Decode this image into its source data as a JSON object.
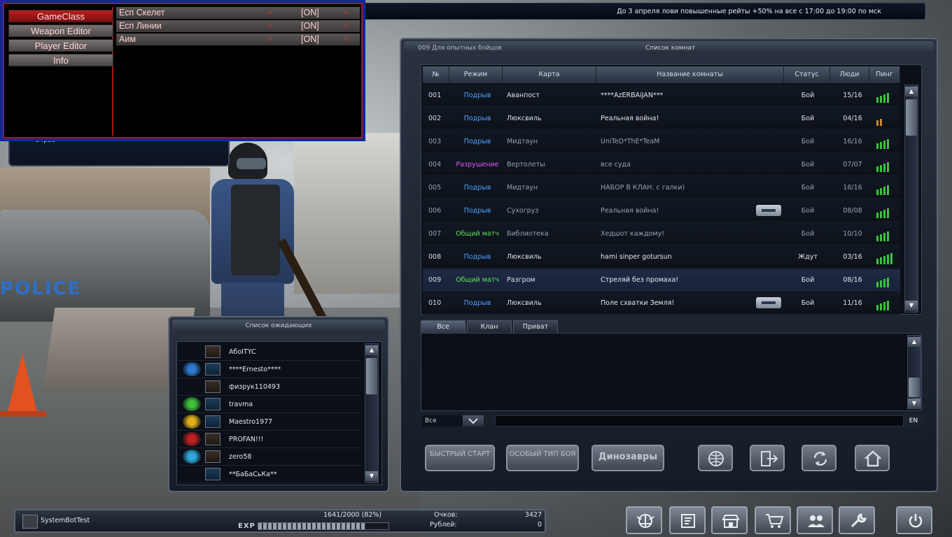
{
  "ticker": "До 3 апреля лови повышенные рейты +50% на все с 17:00 до 19:00 по мск",
  "cheat_menu": {
    "tabs": [
      "GameClass",
      "Weapon Editor",
      "Player Editor",
      "Info"
    ],
    "active_tab": "GameClass",
    "options": [
      {
        "label": "Есп Скелет",
        "value": "[ON]"
      },
      {
        "label": "Есп Линии",
        "value": "[ON]"
      },
      {
        "label": "Аим",
        "value": "[ON]"
      }
    ],
    "arrow_left": "«",
    "arrow_right": "»"
  },
  "userbox": {
    "text": "Отрас"
  },
  "room_window": {
    "group": "009 Для опытных бойцов",
    "title": "Список комнат",
    "columns": [
      "№",
      "Режим",
      "Карта",
      "Название комнаты",
      "Статус",
      "Люди",
      "Пинг"
    ],
    "rooms": [
      {
        "no": "001",
        "mode": "Подрыв",
        "mode_color": "blue",
        "map": "Аванпост",
        "name": "****AzERBAiJAN***",
        "status": "Бой",
        "people": "15/16",
        "ping": 4,
        "locked": false,
        "dim": false
      },
      {
        "no": "002",
        "mode": "Подрыв",
        "mode_color": "blue",
        "map": "Люксвиль",
        "name": "Реальная войнa!",
        "status": "Бой",
        "people": "04/16",
        "ping": 2,
        "locked": false,
        "dim": false
      },
      {
        "no": "003",
        "mode": "Подрыв",
        "mode_color": "blue",
        "map": "Мидтаун",
        "name": "UniTeD*ThE*TeaM",
        "status": "Бой",
        "people": "16/16",
        "ping": 4,
        "locked": false,
        "dim": true
      },
      {
        "no": "004",
        "mode": "Разрушение",
        "mode_color": "pink",
        "map": "Вертолеты",
        "name": "все суда",
        "status": "Бой",
        "people": "07/07",
        "ping": 4,
        "locked": false,
        "dim": true
      },
      {
        "no": "005",
        "mode": "Подрыв",
        "mode_color": "blue",
        "map": "Мидтаун",
        "name": "НАБОР В КЛАН. с галки)",
        "status": "Бой",
        "people": "16/16",
        "ping": 4,
        "locked": false,
        "dim": true
      },
      {
        "no": "006",
        "mode": "Подрыв",
        "mode_color": "blue",
        "map": "Сухогруз",
        "name": "Реальная войнa!",
        "status": "Бой",
        "people": "08/08",
        "ping": 4,
        "locked": true,
        "dim": true
      },
      {
        "no": "007",
        "mode": "Общий матч",
        "mode_color": "green",
        "map": "Библиотека",
        "name": "Хедшот каждому!",
        "status": "Бой",
        "people": "10/10",
        "ping": 4,
        "locked": false,
        "dim": true
      },
      {
        "no": "008",
        "mode": "Подрыв",
        "mode_color": "blue",
        "map": "Люксвиль",
        "name": "hami sinper  gotursun",
        "status": "Ждут",
        "people": "03/16",
        "ping": 5,
        "locked": false,
        "dim": false
      },
      {
        "no": "009",
        "mode": "Общий матч",
        "mode_color": "green",
        "map": "Разгром",
        "name": "Стреляй без промаха!",
        "status": "Бой",
        "people": "08/16",
        "ping": 4,
        "locked": false,
        "dim": false,
        "selected": true
      },
      {
        "no": "010",
        "mode": "Подрыв",
        "mode_color": "blue",
        "map": "Люксвиль",
        "name": "Поле схватки Земля!",
        "status": "Бой",
        "people": "11/16",
        "ping": 4,
        "locked": true,
        "dim": false
      }
    ],
    "chat_tabs": [
      "Все",
      "Клан",
      "Приват"
    ],
    "chat_target": "Все",
    "lang": "EN",
    "buttons": {
      "quick_start": "БЫСТРЫЙ СТАРТ",
      "special": "ОСОБЫЙ ТИП БОЯ",
      "dino": "Динозавры"
    },
    "icon_buttons": [
      "globe-icon",
      "exit-icon",
      "refresh-icon",
      "home-icon"
    ]
  },
  "waiting": {
    "title": "Список ожидающих",
    "players": [
      {
        "name": "AбoITYC",
        "clan": "",
        "rank": "brown"
      },
      {
        "name": "****Ernesto****",
        "clan": "#2f7bd1",
        "rank": "blue"
      },
      {
        "name": "физрук110493",
        "clan": "",
        "rank": "brown"
      },
      {
        "name": "travma",
        "clan": "#3fbf3a",
        "rank": "blue"
      },
      {
        "name": "Maestro1977",
        "clan": "#e0b01c",
        "rank": "blue"
      },
      {
        "name": "PROFAN!!!",
        "clan": "#c22020",
        "rank": "brown"
      },
      {
        "name": "zero58",
        "clan": "#2fa8d8",
        "rank": "brown"
      },
      {
        "name": "**БаБаСьКа**",
        "clan": "",
        "rank": "blue"
      }
    ]
  },
  "bottom": {
    "user": "SystemBotTest",
    "exp_text": "1641/2000 (82%)",
    "exp_label": "EXP",
    "exp_fraction": 0.82,
    "points_label": "Очков:",
    "points": "3427",
    "rub_label": "Рублей:",
    "rub": "0"
  },
  "nav_icons": [
    "clan-emblem-icon",
    "notes-icon",
    "store-icon",
    "cart-icon",
    "friends-icon",
    "wrench-icon",
    "power-icon"
  ]
}
